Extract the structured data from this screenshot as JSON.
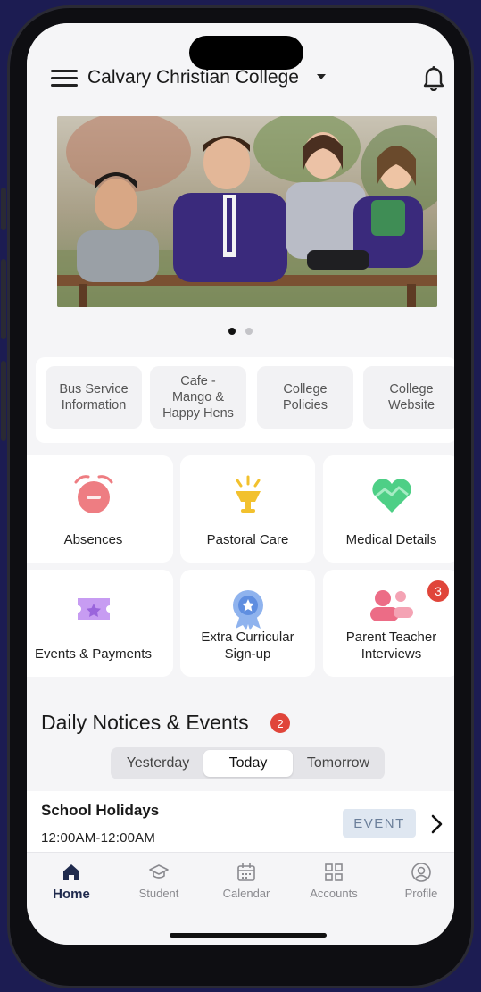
{
  "header": {
    "school_name": "Calvary Christian College",
    "icons": [
      "menu-icon",
      "caret-down-icon",
      "bell-icon"
    ]
  },
  "banner": {
    "slide_count": 2,
    "active_slide": 1
  },
  "quick_links": [
    {
      "label": "Bus Service\nInformation"
    },
    {
      "label": "Cafe -\nMango &\nHappy Hens"
    },
    {
      "label": "College\nPolicies"
    },
    {
      "label": "College\nWebsite"
    }
  ],
  "tiles": [
    {
      "label": "Absences",
      "icon": "alarm-clock-icon"
    },
    {
      "label": "Pastoral Care",
      "icon": "trophy-icon"
    },
    {
      "label": "Medical Details",
      "icon": "heart-icon"
    },
    {
      "label": "Events & Payments",
      "icon": "ticket-icon"
    },
    {
      "label": "Extra Curricular\nSign-up",
      "icon": "award-ribbon-icon"
    },
    {
      "label": "Parent Teacher\nInterviews",
      "icon": "people-icon",
      "badge": "3"
    }
  ],
  "notices": {
    "title": "Daily Notices & Events",
    "badge": "2",
    "tabs": [
      "Yesterday",
      "Today",
      "Tomorrow"
    ],
    "active_tab": "Today",
    "event": {
      "title": "School Holidays",
      "time": "12:00AM-12:00AM",
      "tag": "EVENT"
    }
  },
  "tabbar": [
    {
      "label": "Home",
      "icon": "home-icon",
      "active": true
    },
    {
      "label": "Student",
      "icon": "graduation-cap-icon"
    },
    {
      "label": "Calendar",
      "icon": "calendar-icon"
    },
    {
      "label": "Accounts",
      "icon": "grid-icon"
    },
    {
      "label": "Profile",
      "icon": "profile-icon"
    }
  ],
  "colors": {
    "background": "#1c1c52",
    "badge": "#e0453a",
    "nav_active": "#1f2a4d",
    "absences": "#ee7d82",
    "pastoral": "#f2c12e",
    "medical": "#4ecf86",
    "events": "#c79cf2",
    "extra": "#8fb3ee",
    "interviews": "#ec6c86"
  }
}
